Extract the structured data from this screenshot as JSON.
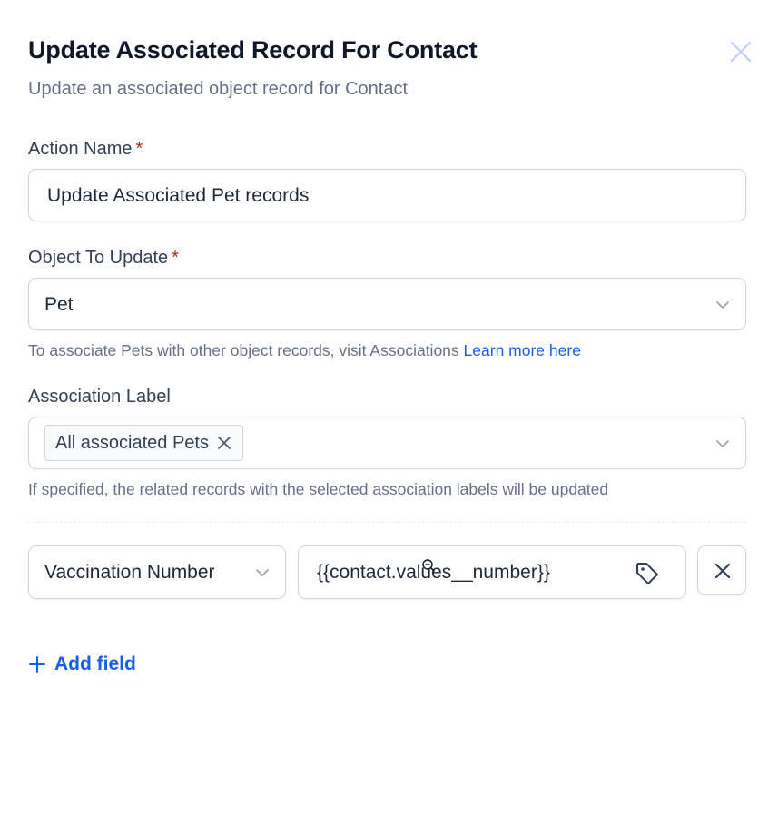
{
  "dialog": {
    "title": "Update Associated Record For Contact",
    "subtitle": "Update an associated object record for Contact",
    "close_icon": "close-icon"
  },
  "action_name": {
    "label": "Action Name",
    "required_mark": "*",
    "value": "Update Associated Pet records"
  },
  "object_to_update": {
    "label": "Object To Update",
    "required_mark": "*",
    "selected": "Pet",
    "help_text": "To associate Pets with other object records, visit Associations",
    "help_link": "Learn more here"
  },
  "association_label": {
    "label": "Association Label",
    "chip": "All associated Pets",
    "help_text": "If specified, the related records with the selected association labels will be updated"
  },
  "field_row": {
    "field_selected": "Vaccination Number",
    "value_text": "{{contact.values__number}}",
    "tag_icon": "tag-icon",
    "remove_icon": "close-icon"
  },
  "add_field": {
    "label": "Add field",
    "icon": "plus-icon"
  },
  "colors": {
    "link": "#155eef",
    "required": "#b42318",
    "border": "#d0d5dd",
    "muted_text": "#667085"
  }
}
